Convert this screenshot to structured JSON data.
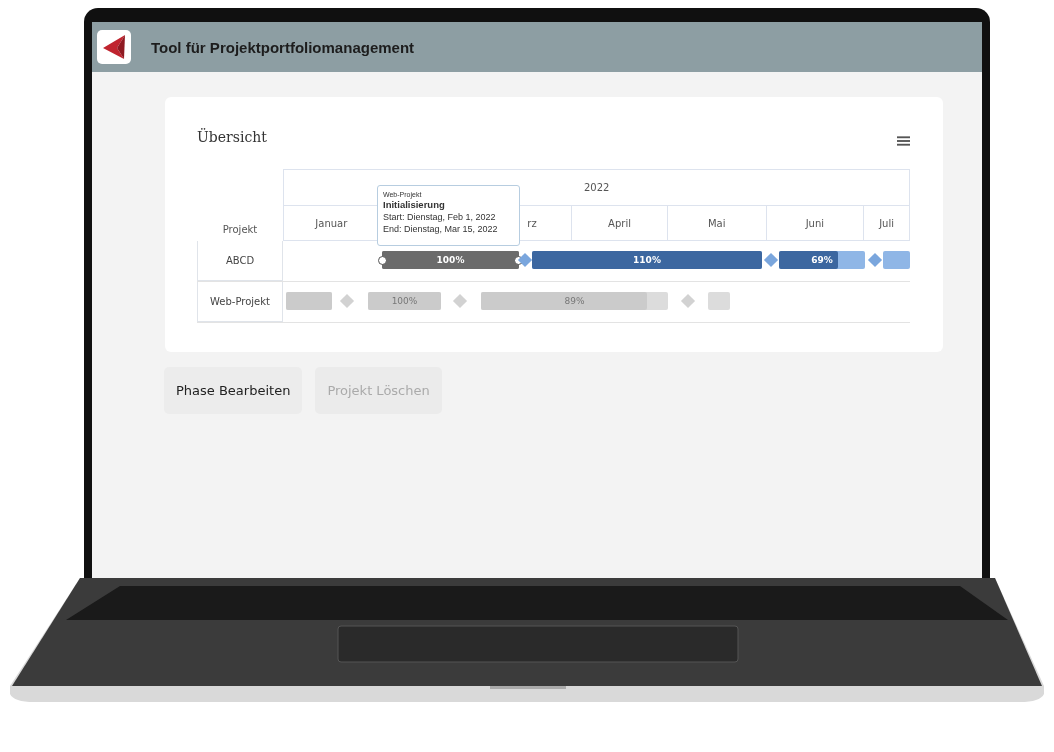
{
  "app": {
    "title": "Tool für Projektportfoliomanagement"
  },
  "overview": {
    "title": "Übersicht",
    "column_header": "Projekt",
    "year": "2022",
    "months": [
      "Januar",
      "rz",
      "April",
      "Mai",
      "Juni",
      "Juli"
    ],
    "rows": [
      {
        "name": "ABCD",
        "dimmed": false,
        "items": [
          {
            "kind": "bar",
            "label": "100%",
            "level": 1,
            "selected": true
          },
          {
            "kind": "milestone"
          },
          {
            "kind": "bar",
            "label": "110%",
            "level": 1,
            "selected": false
          },
          {
            "kind": "milestone"
          },
          {
            "kind": "bar",
            "label": "69%",
            "level": 0.69,
            "selected": false
          },
          {
            "kind": "milestone"
          },
          {
            "kind": "bar",
            "level": 0,
            "selected": false
          }
        ]
      },
      {
        "name": "Web-Projekt",
        "dimmed": true,
        "items": [
          {
            "kind": "bar",
            "level": 1,
            "selected": false
          },
          {
            "kind": "milestone"
          },
          {
            "kind": "bar",
            "label": "100%",
            "level": 1,
            "selected": false
          },
          {
            "kind": "milestone"
          },
          {
            "kind": "bar",
            "label": "89%",
            "level": 0.89,
            "selected": false
          },
          {
            "kind": "milestone"
          },
          {
            "kind": "bar",
            "level": 0,
            "selected": false
          }
        ]
      }
    ],
    "tooltip": {
      "project": "Web-Projekt",
      "phase": "Initialisierung",
      "start": "Start: Dienstag, Feb 1, 2022",
      "end": "End: Dienstag, Mar 15, 2022"
    }
  },
  "buttons": [
    {
      "label": "Phase Bearbeiten",
      "disabled": false
    },
    {
      "label": "Projekt Löschen",
      "disabled": true
    }
  ]
}
